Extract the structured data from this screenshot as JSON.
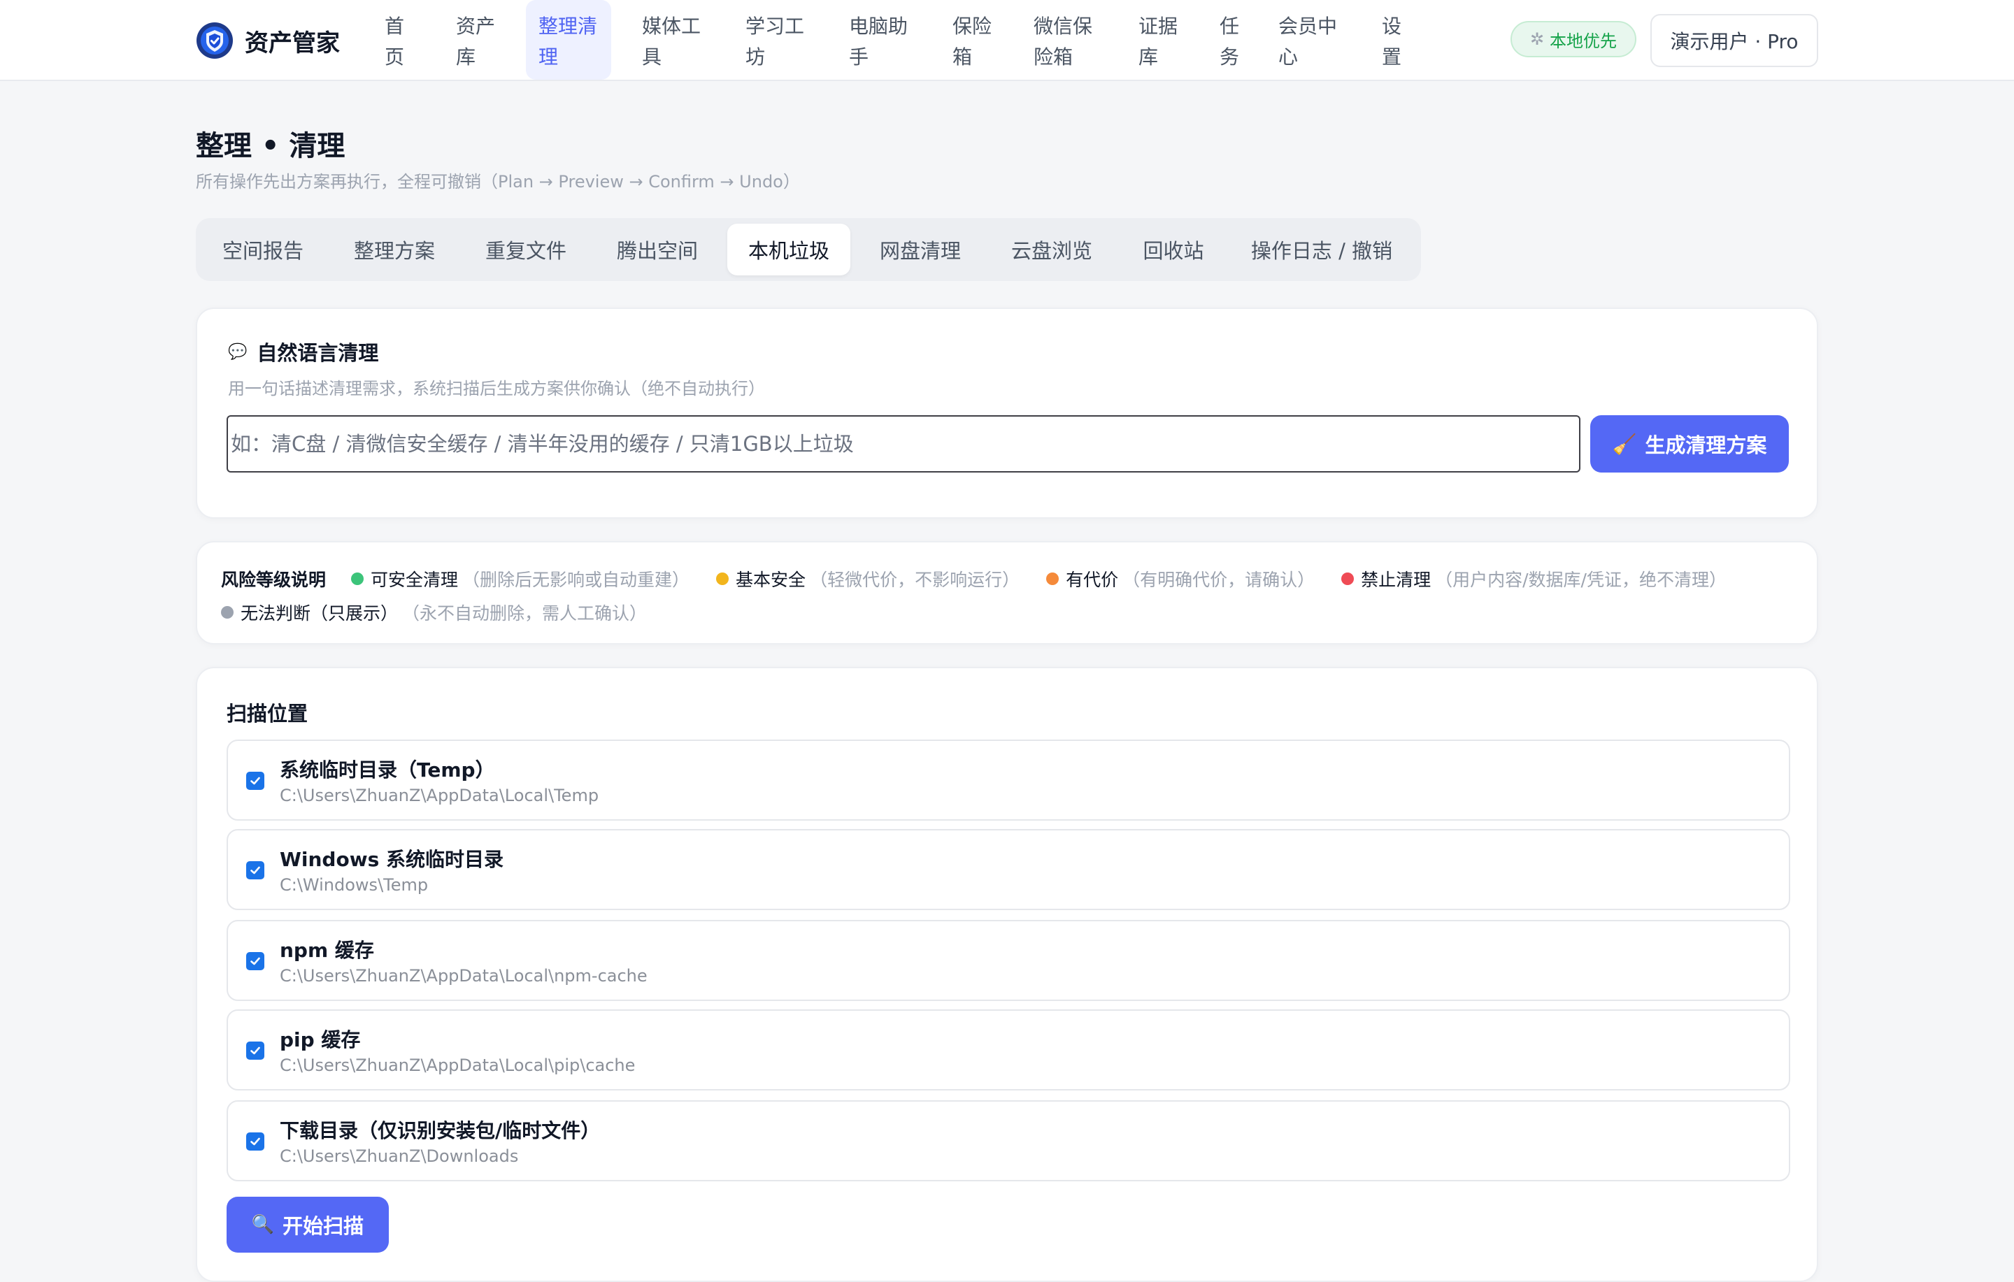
{
  "app": {
    "brand": "资产管家",
    "local_badge": "本地优先",
    "user_button": "演示用户 · Pro"
  },
  "nav": [
    {
      "label": "首\n页",
      "active": false
    },
    {
      "label": "资产\n库",
      "active": false
    },
    {
      "label": "整理清\n理",
      "active": true
    },
    {
      "label": "媒体工\n具",
      "active": false
    },
    {
      "label": "学习工\n坊",
      "active": false
    },
    {
      "label": "电脑助\n手",
      "active": false
    },
    {
      "label": "保险\n箱",
      "active": false
    },
    {
      "label": "微信保\n险箱",
      "active": false
    },
    {
      "label": "证据\n库",
      "active": false
    },
    {
      "label": "任\n务",
      "active": false
    },
    {
      "label": "会员中\n心",
      "active": false
    },
    {
      "label": "设\n置",
      "active": false
    }
  ],
  "page": {
    "title": "整理 • 清理",
    "subtitle": "所有操作先出方案再执行，全程可撤销（Plan → Preview → Confirm → Undo）"
  },
  "tabs": [
    {
      "label": "空间报告",
      "active": false
    },
    {
      "label": "整理方案",
      "active": false
    },
    {
      "label": "重复文件",
      "active": false
    },
    {
      "label": "腾出空间",
      "active": false
    },
    {
      "label": "本机垃圾",
      "active": true
    },
    {
      "label": "网盘清理",
      "active": false
    },
    {
      "label": "云盘浏览",
      "active": false
    },
    {
      "label": "回收站",
      "active": false
    },
    {
      "label": "操作日志 / 撤销",
      "active": false
    }
  ],
  "nl_clean": {
    "title": "自然语言清理",
    "description": "用一句话描述清理需求，系统扫描后生成方案供你确认（绝不自动执行）",
    "input_value": "",
    "placeholder": "如：清C盘 / 清微信安全缓存 / 清半年没用的缓存 / 只清1GB以上垃圾",
    "button_label": "生成清理方案"
  },
  "risk_legend": {
    "title": "风险等级说明",
    "levels": [
      {
        "label": "可安全清理",
        "note": "（删除后无影响或自动重建）",
        "color": "#3cc47a"
      },
      {
        "label": "基本安全",
        "note": "（轻微代价，不影响运行）",
        "color": "#f2b51d"
      },
      {
        "label": "有代价",
        "note": "（有明确代价，请确认）",
        "color": "#f58a3a"
      },
      {
        "label": "禁止清理",
        "note": "（用户内容/数据库/凭证，绝不清理）",
        "color": "#ef4b55"
      },
      {
        "label": "无法判断（只展示）",
        "note": "（永不自动删除，需人工确认）",
        "color": "#9ca3af"
      }
    ]
  },
  "scan": {
    "title": "扫描位置",
    "locations": [
      {
        "name": "系统临时目录（Temp）",
        "path": "C:\\Users\\ZhuanZ\\AppData\\Local\\Temp",
        "checked": true
      },
      {
        "name": "Windows 系统临时目录",
        "path": "C:\\Windows\\Temp",
        "checked": true
      },
      {
        "name": "npm 缓存",
        "path": "C:\\Users\\ZhuanZ\\AppData\\Local\\npm-cache",
        "checked": true
      },
      {
        "name": "pip 缓存",
        "path": "C:\\Users\\ZhuanZ\\AppData\\Local\\pip\\cache",
        "checked": true
      },
      {
        "name": "下载目录（仅识别安装包/临时文件）",
        "path": "C:\\Users\\ZhuanZ\\Downloads",
        "checked": true
      }
    ],
    "button_label": "开始扫描"
  },
  "colors": {
    "accent": "#5468f5",
    "nav_active_bg": "#eef1ff",
    "checkbox": "#1a73e8"
  }
}
